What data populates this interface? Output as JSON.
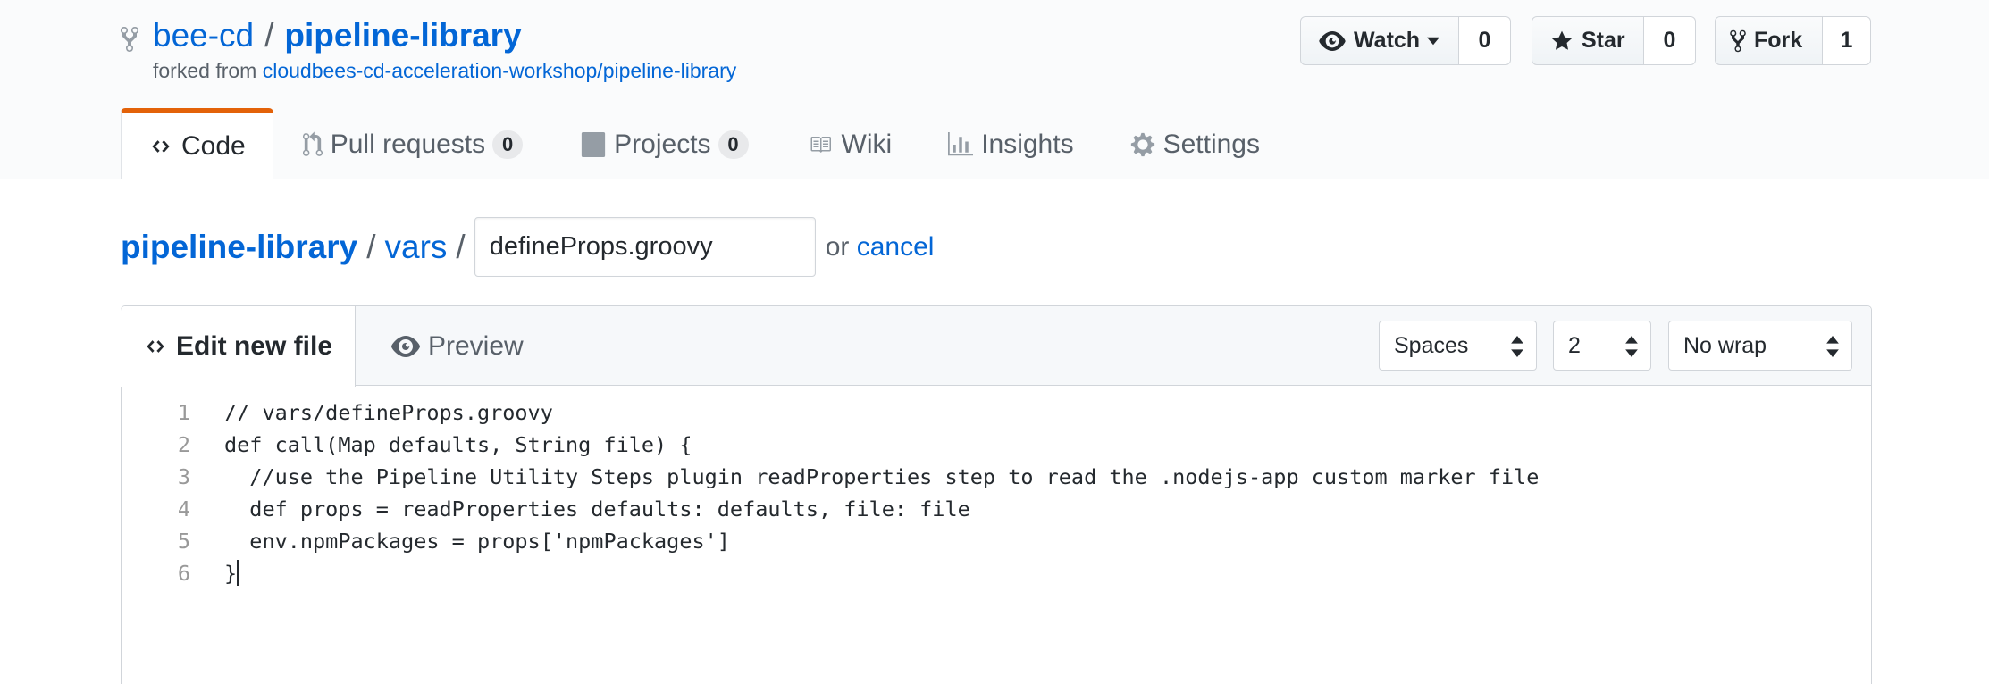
{
  "repo": {
    "owner": "bee-cd",
    "separator": "/",
    "name": "pipeline-library",
    "forked_prefix": "forked from",
    "forked_from": "cloudbees-cd-acceleration-workshop/pipeline-library"
  },
  "actions": {
    "watch_label": "Watch",
    "watch_count": "0",
    "star_label": "Star",
    "star_count": "0",
    "fork_label": "Fork",
    "fork_count": "1"
  },
  "tabs": [
    {
      "label": "Code",
      "icon": "code-icon",
      "selected": true
    },
    {
      "label": "Pull requests",
      "count": "0",
      "icon": "git-pull-request-icon"
    },
    {
      "label": "Projects",
      "count": "0",
      "icon": "project-icon"
    },
    {
      "label": "Wiki",
      "icon": "book-icon"
    },
    {
      "label": "Insights",
      "icon": "graph-icon"
    },
    {
      "label": "Settings",
      "icon": "gear-icon"
    }
  ],
  "breadcrumb": {
    "root": "pipeline-library",
    "sep": "/",
    "dir": "vars",
    "filename": "defineProps.groovy",
    "or_text": "or",
    "cancel_label": "cancel"
  },
  "editor": {
    "edit_tab": "Edit new file",
    "preview_tab": "Preview",
    "indent_mode": "Spaces",
    "indent_size": "2",
    "wrap_mode": "No wrap",
    "lines": [
      {
        "num": "1",
        "text": "// vars/defineProps.groovy"
      },
      {
        "num": "2",
        "text": "def call(Map defaults, String file) {"
      },
      {
        "num": "3",
        "text": "  //use the Pipeline Utility Steps plugin readProperties step to read the .nodejs-app custom marker file"
      },
      {
        "num": "4",
        "text": "  def props = readProperties defaults: defaults, file: file"
      },
      {
        "num": "5",
        "text": "  env.npmPackages = props['npmPackages']"
      },
      {
        "num": "6",
        "text": "}"
      }
    ]
  },
  "colors": {
    "link": "#0366d6",
    "selected_tab_accent": "#e36209",
    "muted_text": "#586069",
    "border": "#d1d5da"
  }
}
